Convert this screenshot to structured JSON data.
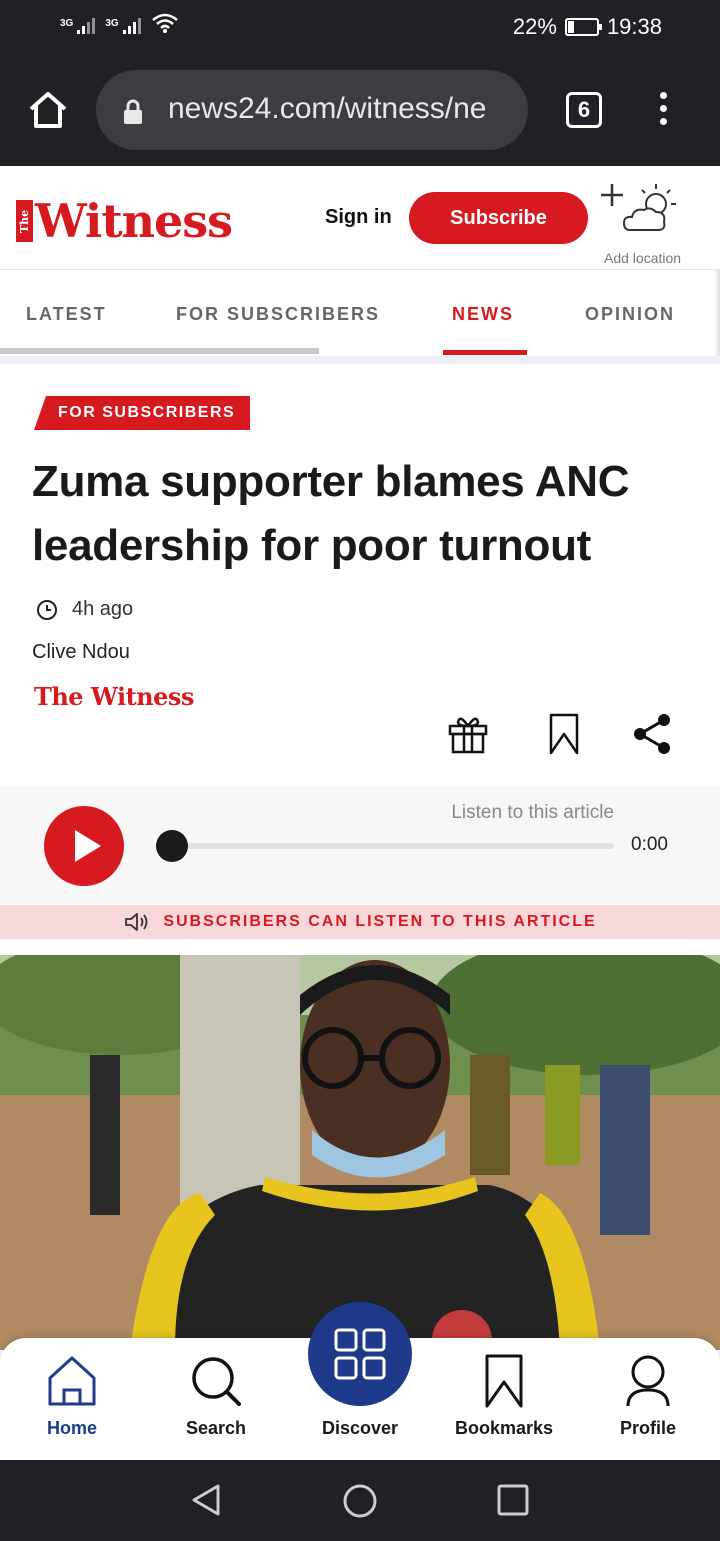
{
  "status_bar": {
    "network_1": "3G",
    "network_2": "3G",
    "battery_percent": "22%",
    "battery_level": 0.22,
    "time": "19:38"
  },
  "browser": {
    "url": "news24.com/witness/ne",
    "tab_count": "6"
  },
  "site_header": {
    "logo_small": "The",
    "logo_text": "Witness",
    "sign_in_label": "Sign in",
    "subscribe_label": "Subscribe",
    "weather_label": "Add location"
  },
  "nav": {
    "tabs": [
      {
        "label": "LATEST",
        "active": false
      },
      {
        "label": "FOR SUBSCRIBERS",
        "active": false
      },
      {
        "label": "NEWS",
        "active": true
      },
      {
        "label": "OPINION",
        "active": false
      }
    ]
  },
  "article": {
    "badge": "FOR SUBSCRIBERS",
    "headline": "Zuma supporter blames ANC leadership for poor turnout",
    "time_ago": "4h ago",
    "author": "Clive Ndou",
    "source": "The Witness",
    "actions": [
      "gift-icon",
      "bookmark-icon",
      "share-icon"
    ]
  },
  "audio": {
    "listen_label": "Listen to this article",
    "duration": "0:00",
    "progress": 0,
    "subscribers_notice": "SUBSCRIBERS CAN LISTEN TO THIS ARTICLE"
  },
  "bottom_nav": {
    "items": [
      {
        "label": "Home",
        "icon": "home-icon",
        "active": true
      },
      {
        "label": "Search",
        "icon": "search-icon",
        "active": false
      },
      {
        "label": "Discover",
        "icon": "grid-icon",
        "active": false
      },
      {
        "label": "Bookmarks",
        "icon": "bookmark-icon",
        "active": false
      },
      {
        "label": "Profile",
        "icon": "profile-icon",
        "active": false
      }
    ]
  },
  "colors": {
    "brand_red": "#d71920",
    "nav_blue": "#1f3a8a",
    "chrome_dark": "#202124"
  }
}
